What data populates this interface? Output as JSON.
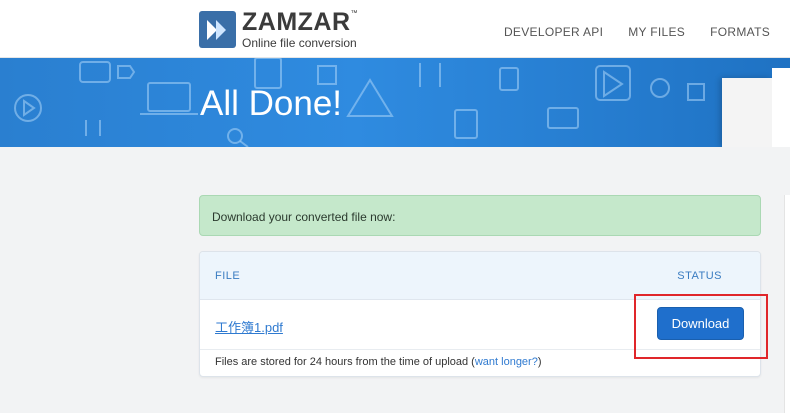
{
  "brand": {
    "name": "ZAMZAR",
    "trademark": "™",
    "tagline": "Online file conversion"
  },
  "nav": {
    "items": [
      "DEVELOPER API",
      "MY FILES",
      "FORMATS"
    ]
  },
  "hero": {
    "title": "All Done!"
  },
  "alert": {
    "text": "Download your converted file now:"
  },
  "files_table": {
    "header_file": "FILE",
    "header_status": "STATUS",
    "rows": [
      {
        "filename": "工作簿1.pdf",
        "action_label": "Download"
      }
    ]
  },
  "footer_note": {
    "text_before": "Files are stored for 24 hours from the time of upload (",
    "link_text": "want longer?",
    "text_after": ")"
  },
  "colors": {
    "accent": "#1f6fcc",
    "hero": "#2f8be0",
    "success_bg": "#c5e8cb",
    "annotation": "#e0262a"
  }
}
